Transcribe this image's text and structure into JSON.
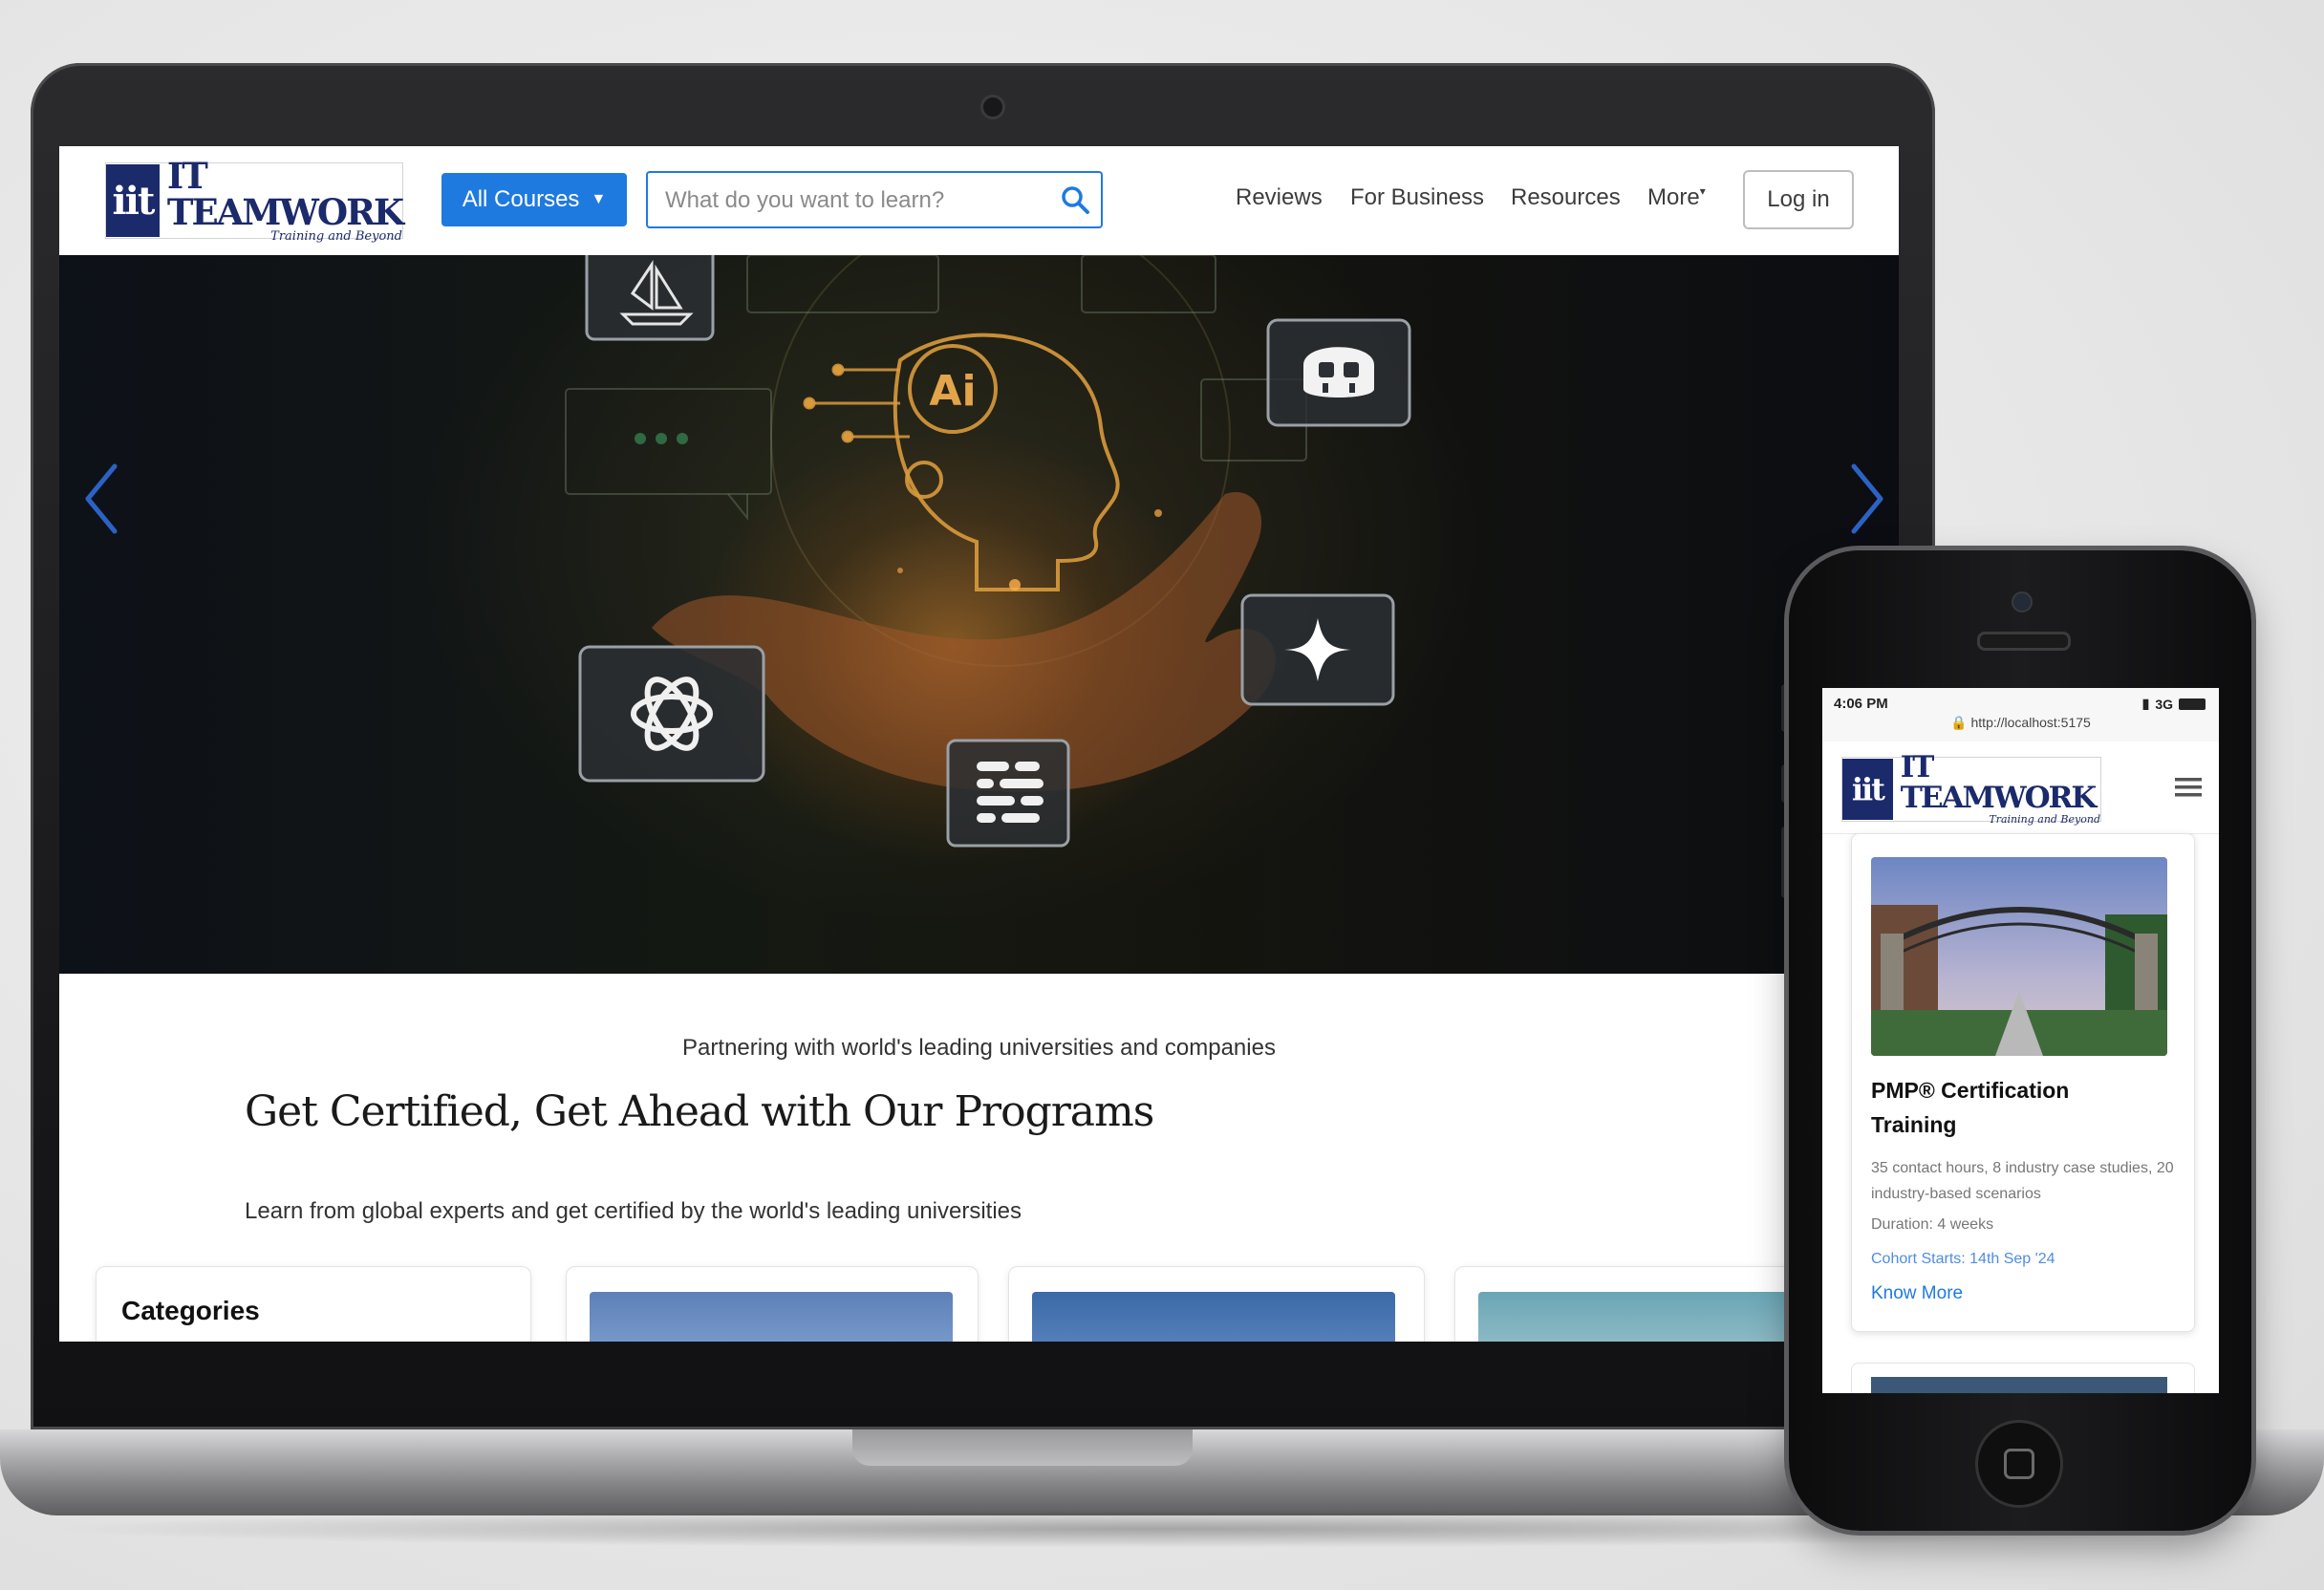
{
  "brand": {
    "logo_mark": "iit",
    "name": "IT TEAMWORK",
    "tagline": "Training and Beyond",
    "primary_color": "#1b2a6b",
    "accent_color": "#1f7ae0"
  },
  "desktop": {
    "header": {
      "all_courses_label": "All Courses",
      "search_placeholder": "What do you want to learn?",
      "nav": {
        "reviews": "Reviews",
        "for_business": "For Business",
        "resources": "Resources",
        "more": "More"
      },
      "login_label": "Log in"
    },
    "hero": {
      "center_badge": "Ai",
      "icons": [
        "midjourney-icon",
        "copilot-icon",
        "openai-icon",
        "gemini-icon",
        "deepseek-icon"
      ]
    },
    "partner_text": "Partnering with world's leading universities and companies",
    "section": {
      "title": "Get Certified, Get Ahead with Our Programs",
      "subtitle": "Learn from global experts and get certified by the world's leading universities"
    },
    "categories_label": "Categories"
  },
  "mobile": {
    "status": {
      "time": "4:06 PM",
      "network": "3G",
      "url": "http://localhost:5175"
    },
    "course_card": {
      "title": "PMP® Certification Training",
      "description": "35 contact hours, 8 industry case studies, 20 industry-based scenarios",
      "duration": "Duration: 4 weeks",
      "cohort": "Cohort Starts: 14th Sep '24",
      "cta": "Know More"
    }
  }
}
